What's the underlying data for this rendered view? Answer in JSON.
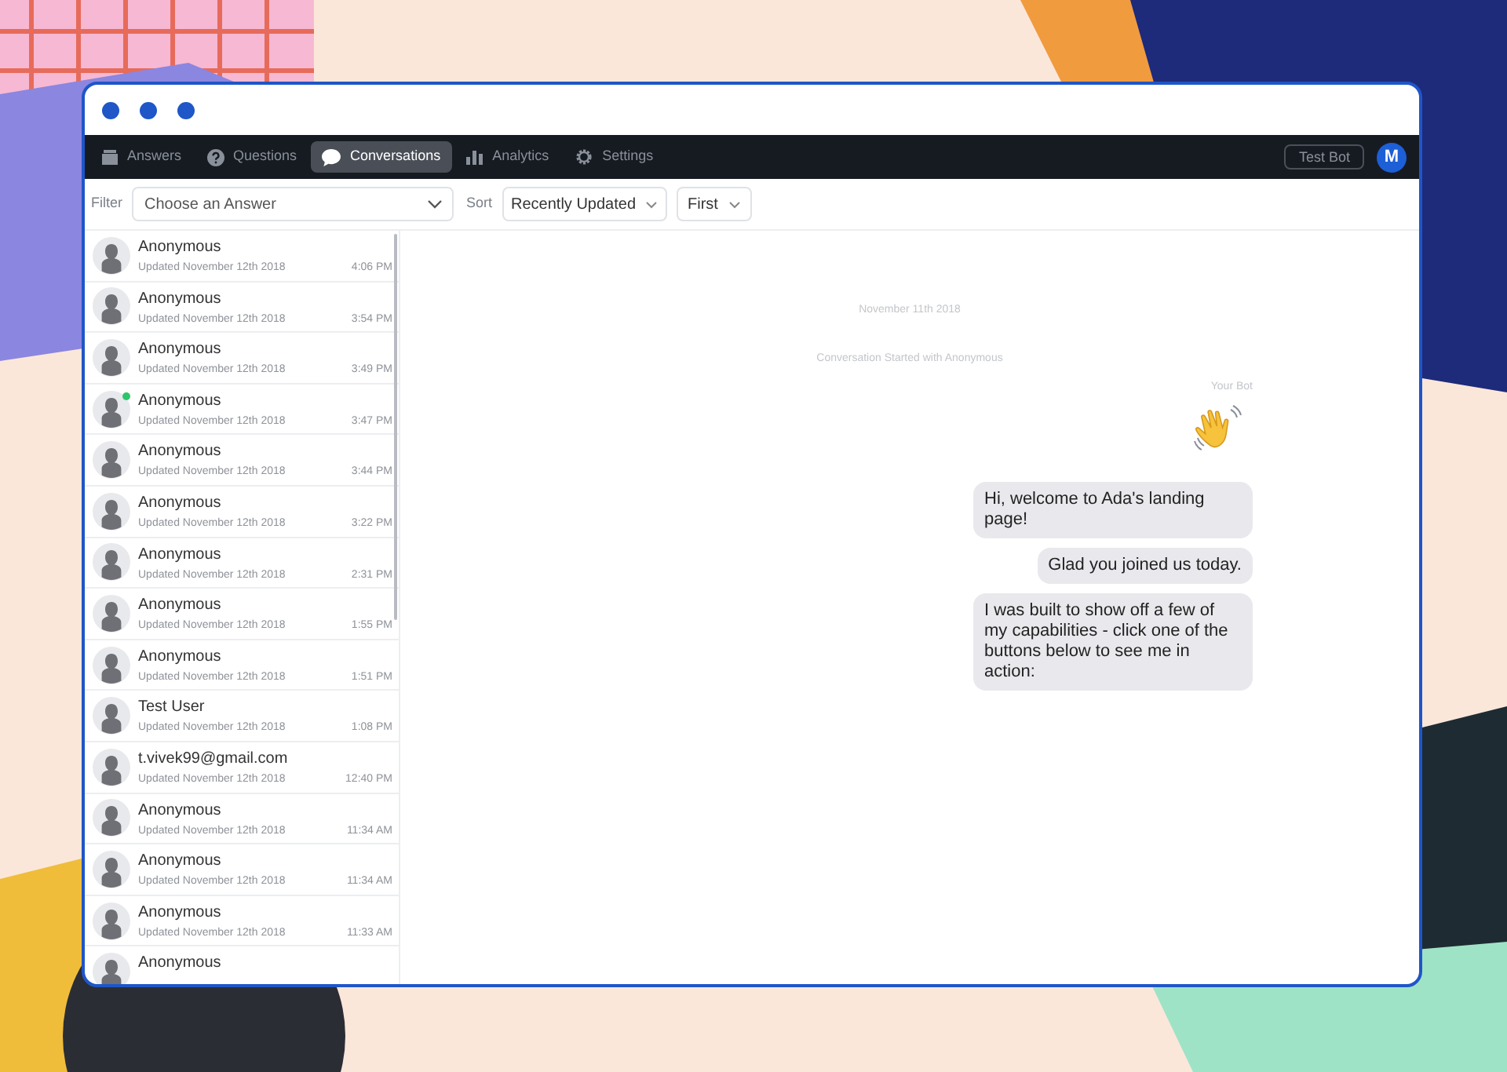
{
  "nav": {
    "tabs": [
      {
        "label": "Answers",
        "kind": "answers",
        "selected": false
      },
      {
        "label": "Questions",
        "kind": "questions",
        "selected": false
      },
      {
        "label": "Conversations",
        "kind": "conversations",
        "selected": true
      },
      {
        "label": "Analytics",
        "kind": "analytics",
        "selected": false
      },
      {
        "label": "Settings",
        "kind": "settings",
        "selected": false
      }
    ],
    "bot_button": "Test Bot",
    "avatar": "M"
  },
  "filter": {
    "label": "Filter",
    "placeholder": "Choose an Answer"
  },
  "sort": {
    "label": "Sort",
    "value": "Recently Updated",
    "order": "First"
  },
  "conversations": [
    {
      "name": "Anonymous",
      "updated": "Updated November 12th 2018",
      "time": "4:06 PM",
      "online": false
    },
    {
      "name": "Anonymous",
      "updated": "Updated November 12th 2018",
      "time": "3:54 PM",
      "online": false
    },
    {
      "name": "Anonymous",
      "updated": "Updated November 12th 2018",
      "time": "3:49 PM",
      "online": false
    },
    {
      "name": "Anonymous",
      "updated": "Updated November 12th 2018",
      "time": "3:47 PM",
      "online": true
    },
    {
      "name": "Anonymous",
      "updated": "Updated November 12th 2018",
      "time": "3:44 PM",
      "online": false
    },
    {
      "name": "Anonymous",
      "updated": "Updated November 12th 2018",
      "time": "3:22 PM",
      "online": false
    },
    {
      "name": "Anonymous",
      "updated": "Updated November 12th 2018",
      "time": "2:31 PM",
      "online": false
    },
    {
      "name": "Anonymous",
      "updated": "Updated November 12th 2018",
      "time": "1:55 PM",
      "online": false
    },
    {
      "name": "Anonymous",
      "updated": "Updated November 12th 2018",
      "time": "1:51 PM",
      "online": false
    },
    {
      "name": "Test User",
      "updated": "Updated November 12th 2018",
      "time": "1:08 PM",
      "online": false
    },
    {
      "name": "t.vivek99@gmail.com",
      "updated": "Updated November 12th 2018",
      "time": "12:40 PM",
      "online": false
    },
    {
      "name": "Anonymous",
      "updated": "Updated November 12th 2018",
      "time": "11:34 AM",
      "online": false
    },
    {
      "name": "Anonymous",
      "updated": "Updated November 12th 2018",
      "time": "11:34 AM",
      "online": false
    },
    {
      "name": "Anonymous",
      "updated": "Updated November 12th 2018",
      "time": "11:33 AM",
      "online": false
    },
    {
      "name": "Anonymous",
      "online": false
    }
  ],
  "chat": {
    "date": "November 11th 2018",
    "started": "Conversation Started with Anonymous",
    "sender": "Your Bot",
    "messages": [
      {
        "kind": "wave"
      },
      {
        "kind": "text",
        "text": "Hi, welcome to Ada's landing page!"
      },
      {
        "kind": "text",
        "text": "Glad you joined us today."
      },
      {
        "kind": "text",
        "text": "I was built to show off a few of my capabilities - click one of the buttons below to see me in action:"
      }
    ]
  }
}
